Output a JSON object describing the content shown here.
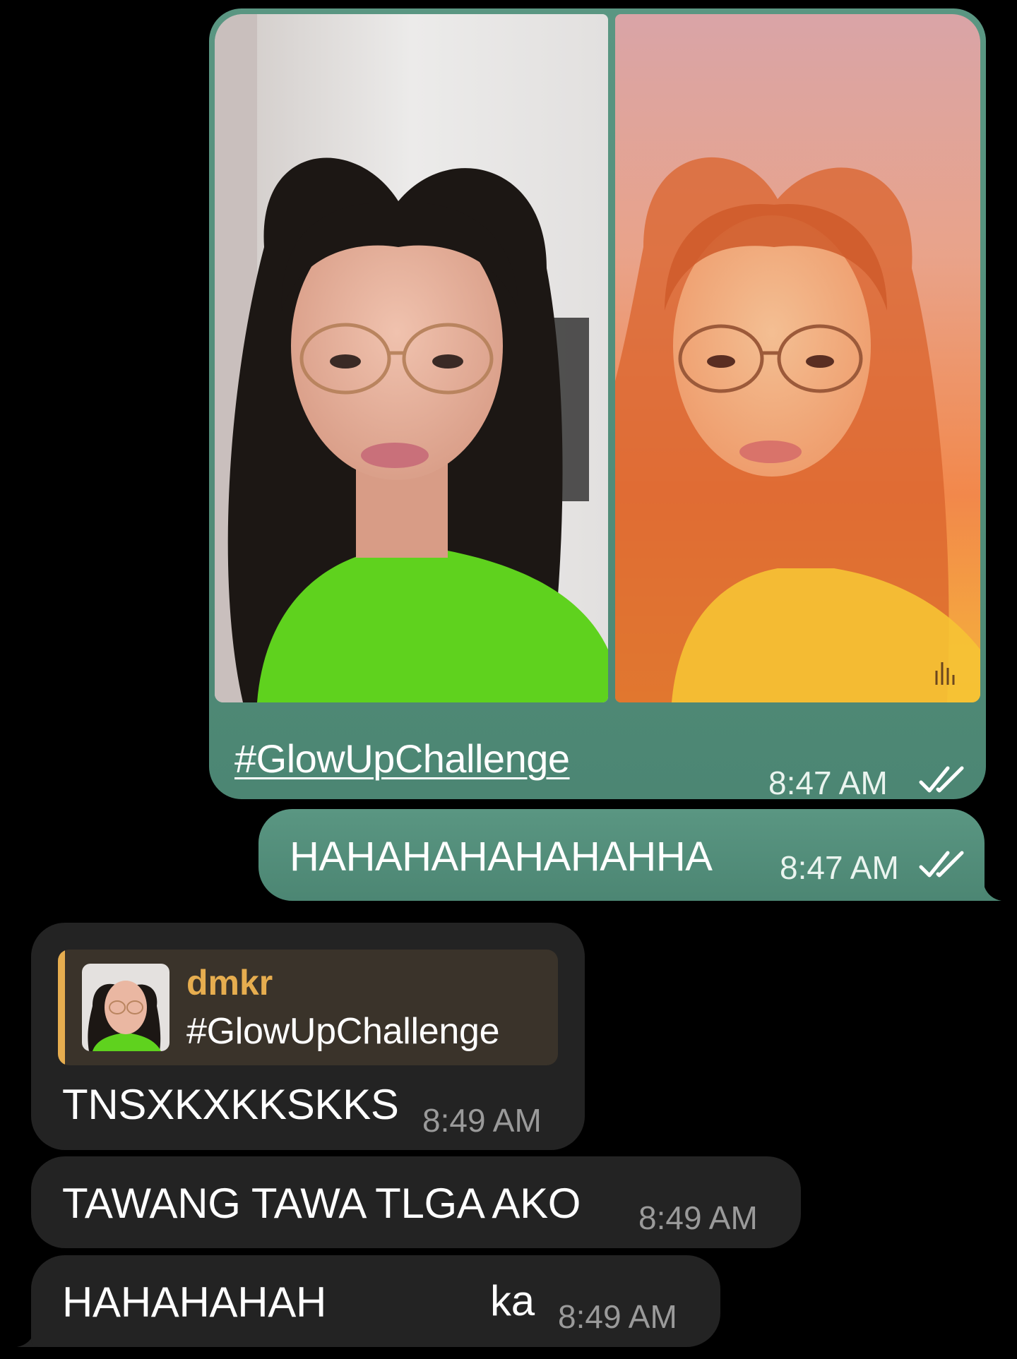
{
  "colors": {
    "outgoing_bubble": "#4f8a77",
    "incoming_bubble": "#232323",
    "reply_accent": "#e6ad4f",
    "background": "#000000"
  },
  "messages": {
    "media_message": {
      "photos": [
        "original-selfie",
        "sunset-filter-selfie"
      ],
      "caption": "#GlowUpChallenge",
      "time": "8:47 AM",
      "status_icon": "double-check-icon"
    },
    "laugh_message": {
      "text": "HAHAHAHAHAHAHHA",
      "time": "8:47 AM",
      "status_icon": "double-check-icon"
    },
    "reply_message": {
      "quoted": {
        "author": "dmkr",
        "text": "#GlowUpChallenge"
      },
      "text": "TNSXKXKKSKKS",
      "time": "8:49 AM"
    },
    "tawa_message": {
      "text": "TAWANG TAWA TLGA AKO",
      "time": "8:49 AM"
    },
    "last_message": {
      "text_start": "HAHAHAHAH",
      "text_end": "ka",
      "time": "8:49 AM"
    }
  }
}
